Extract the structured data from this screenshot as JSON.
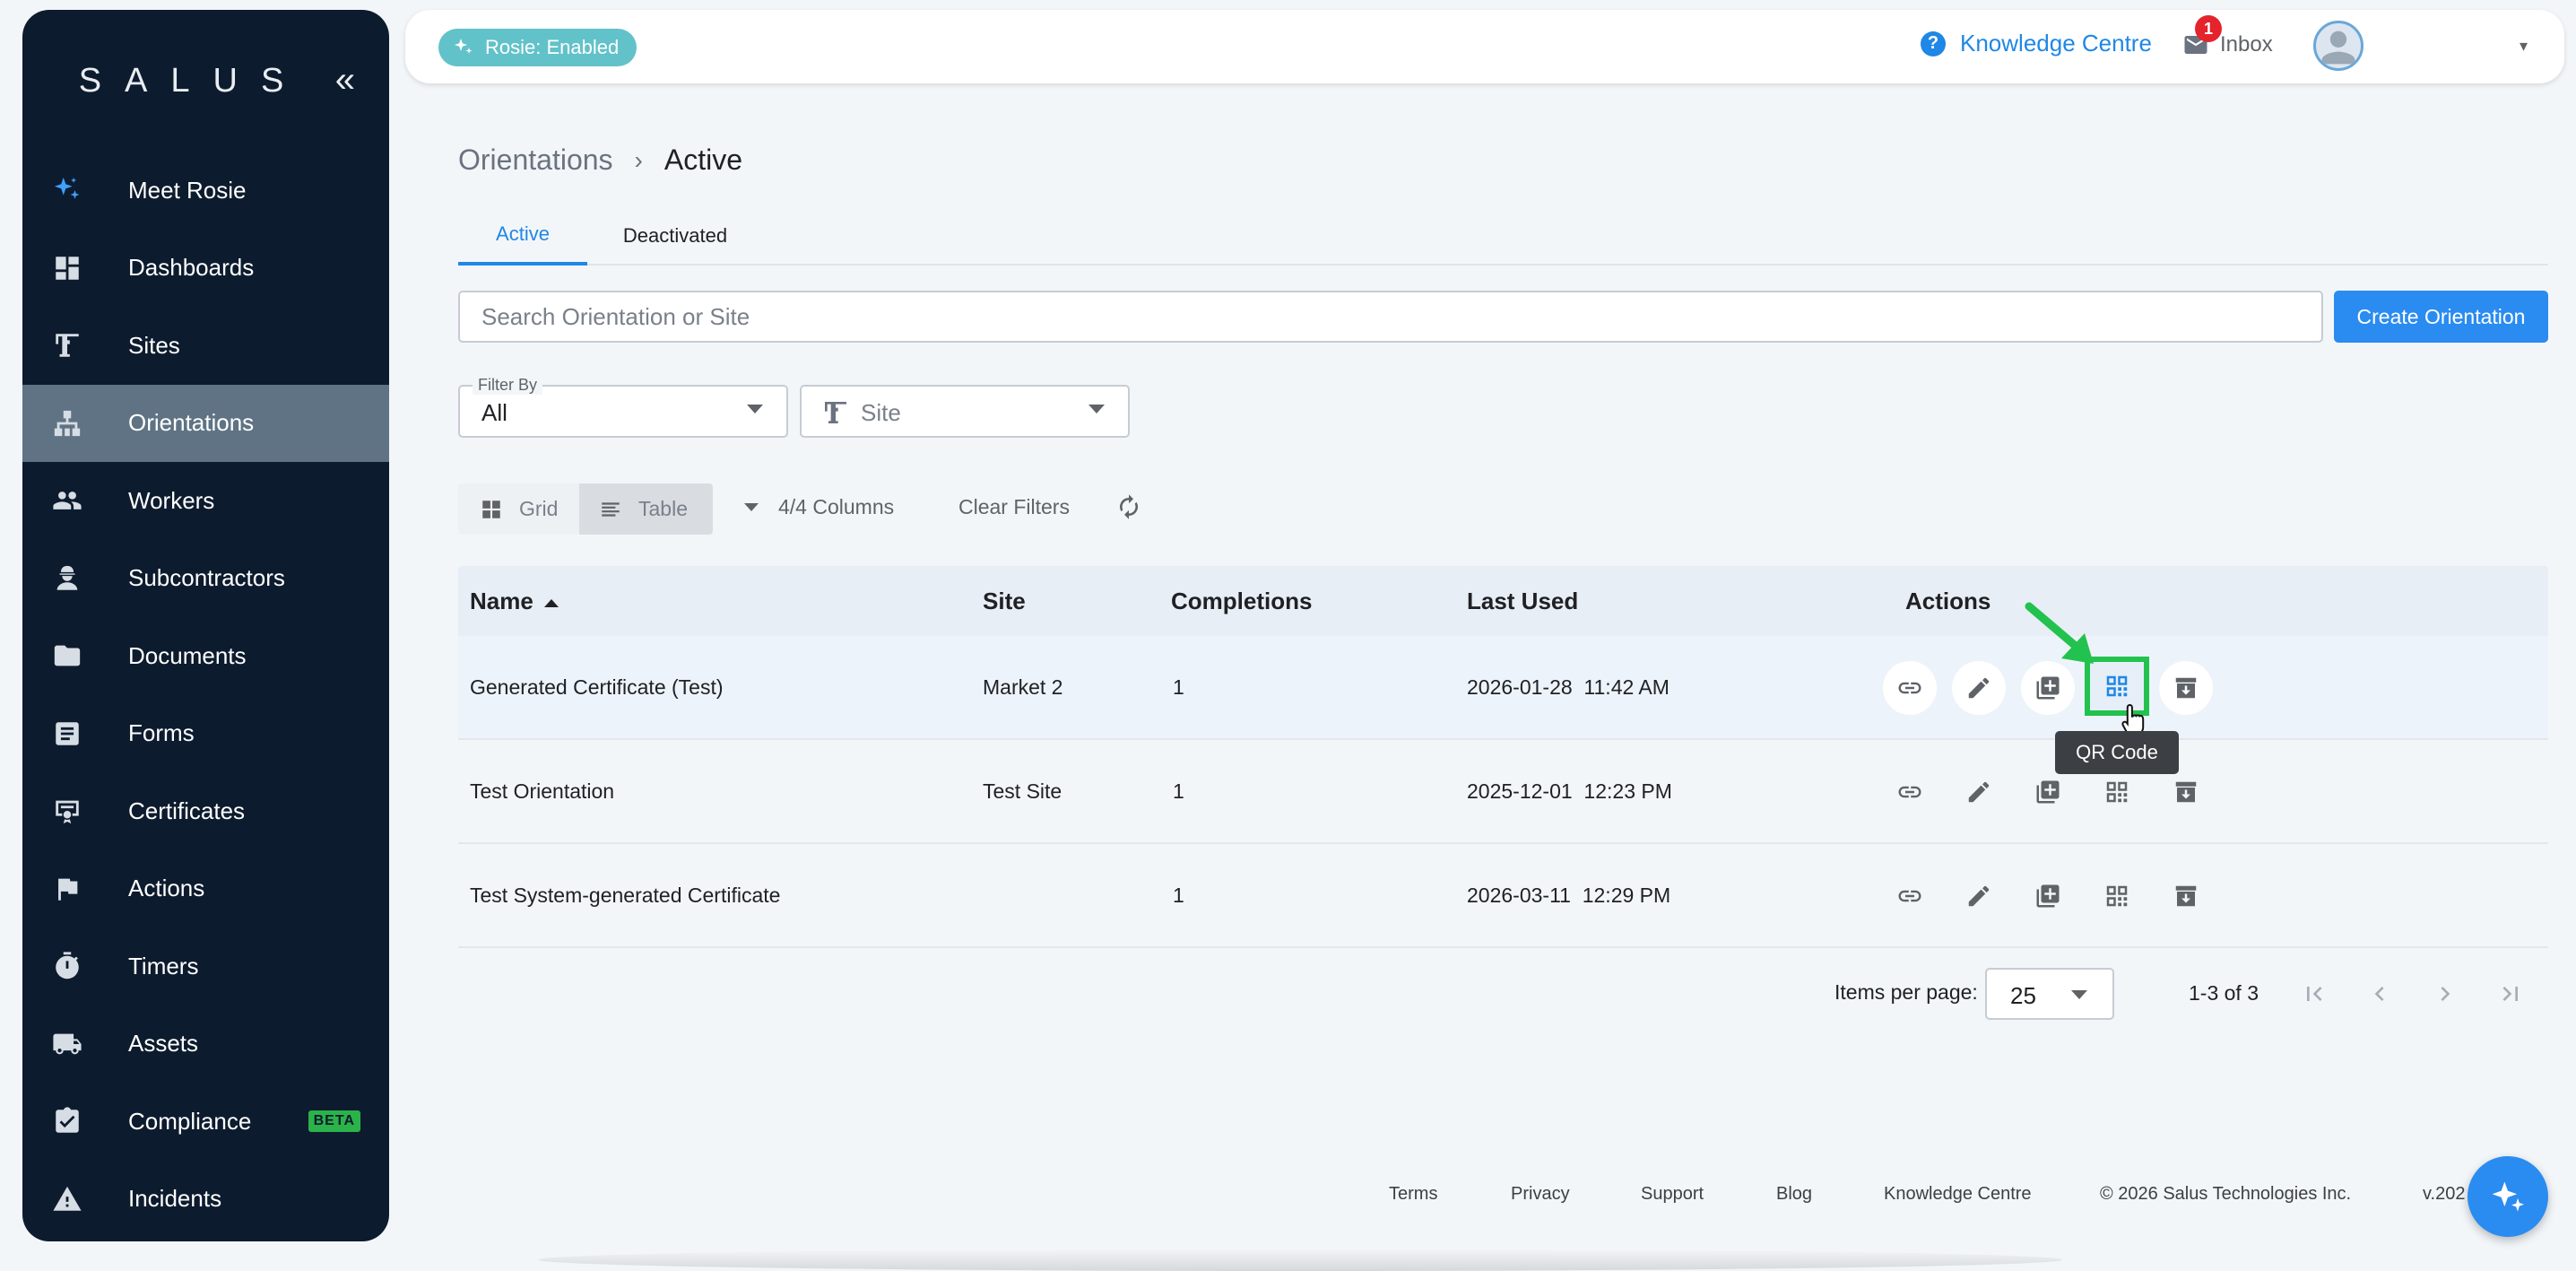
{
  "sidebar": {
    "logo": "SALUS",
    "collapse_icon": "double-chevron-left-icon",
    "items": [
      {
        "label": "Meet Rosie",
        "icon": "sparkle-icon"
      },
      {
        "label": "Dashboards",
        "icon": "dashboard-icon"
      },
      {
        "label": "Sites",
        "icon": "crane-icon"
      },
      {
        "label": "Orientations",
        "icon": "org-chart-icon",
        "active": true
      },
      {
        "label": "Workers",
        "icon": "people-icon"
      },
      {
        "label": "Subcontractors",
        "icon": "hardhat-worker-icon"
      },
      {
        "label": "Documents",
        "icon": "folder-icon"
      },
      {
        "label": "Forms",
        "icon": "form-icon"
      },
      {
        "label": "Certificates",
        "icon": "certificate-icon"
      },
      {
        "label": "Actions",
        "icon": "flag-icon"
      },
      {
        "label": "Timers",
        "icon": "stopwatch-icon"
      },
      {
        "label": "Assets",
        "icon": "truck-icon"
      },
      {
        "label": "Compliance",
        "icon": "clipboard-check-icon",
        "badge": "BETA"
      },
      {
        "label": "Incidents",
        "icon": "warning-icon"
      }
    ]
  },
  "topbar": {
    "rosie_chip": "Rosie: Enabled",
    "knowledge_centre": "Knowledge Centre",
    "inbox_label": "Inbox",
    "inbox_count": "1"
  },
  "breadcrumb": {
    "parent": "Orientations",
    "separator": "›",
    "current": "Active"
  },
  "tabs": {
    "active": "Active",
    "deactivated": "Deactivated"
  },
  "search": {
    "placeholder": "Search Orientation or Site",
    "value": ""
  },
  "create_button": "Create Orientation",
  "filters": {
    "filter_by_label": "Filter By",
    "filter_by_value": "All",
    "site_placeholder": "Site"
  },
  "toolbar": {
    "grid_label": "Grid",
    "table_label": "Table",
    "columns_label": "4/4 Columns",
    "clear_filters": "Clear Filters"
  },
  "table": {
    "headers": {
      "name": "Name",
      "site": "Site",
      "completions": "Completions",
      "last_used": "Last Used",
      "actions": "Actions"
    },
    "rows": [
      {
        "name": "Generated Certificate (Test)",
        "site": "Market 2",
        "completions": "1",
        "last_used": "2026-01-28  11:42 AM"
      },
      {
        "name": "Test Orientation",
        "site": "Test Site",
        "completions": "1",
        "last_used": "2025-12-01  12:23 PM"
      },
      {
        "name": "Test System-generated Certificate",
        "site": "",
        "completions": "1",
        "last_used": "2026-03-11  12:29 PM"
      }
    ],
    "tooltip": "QR Code"
  },
  "pagination": {
    "items_per_page_label": "Items per page:",
    "items_per_page": "25",
    "range": "1-3 of 3"
  },
  "footer": {
    "terms": "Terms",
    "privacy": "Privacy",
    "support": "Support",
    "blog": "Blog",
    "knowledge_centre": "Knowledge Centre",
    "copyright": "© 2026 Salus Technologies Inc.",
    "version": "v.202"
  },
  "colors": {
    "sidebar_bg": "#0d1b2e",
    "primary": "#2a8cf0",
    "highlight_green": "#22c24e",
    "rosie_chip": "#62c2c9"
  }
}
